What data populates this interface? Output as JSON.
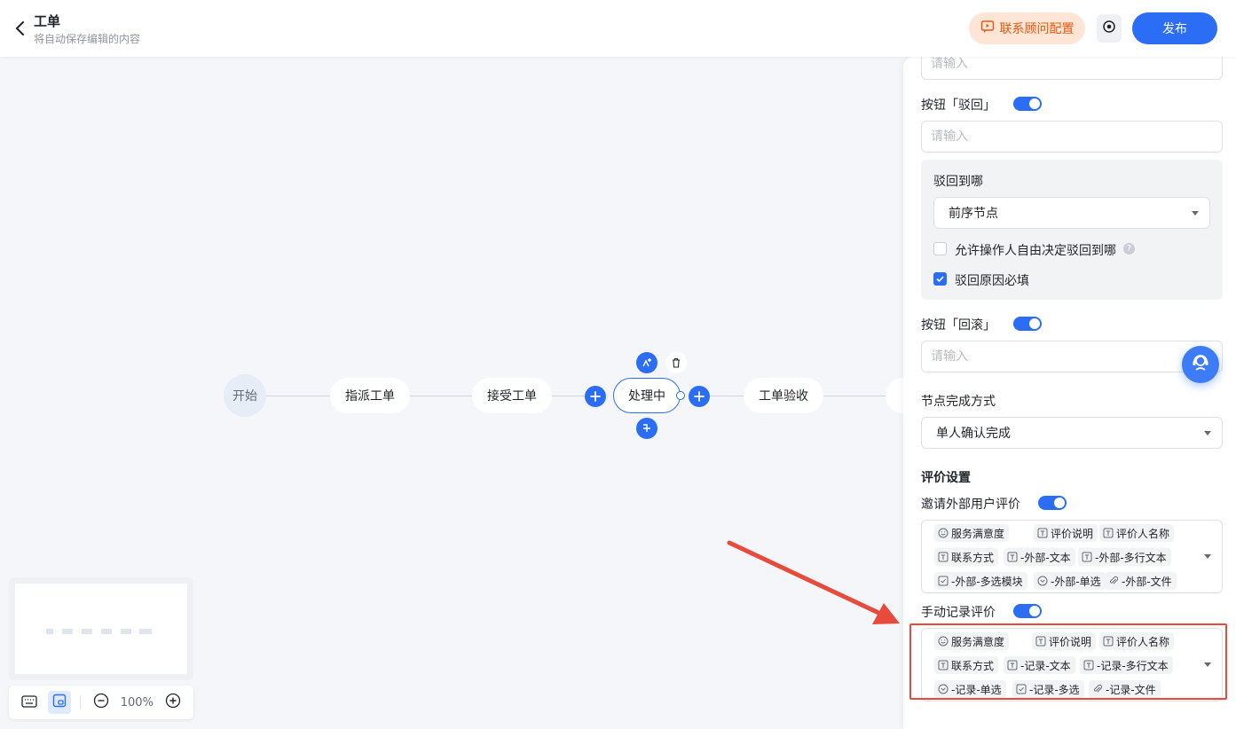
{
  "header": {
    "title": "工单",
    "subtitle": "将自动保存编辑的内容",
    "consult_label": "联系顾问配置",
    "publish_label": "发布"
  },
  "flow": {
    "nodes": [
      "开始",
      "指派工单",
      "接受工单",
      "处理中",
      "工单验收"
    ],
    "active_node": "处理中"
  },
  "zoom": {
    "level": "100%"
  },
  "panel": {
    "top_input_placeholder": "请输入",
    "reject_button_label": "按钮「驳回」",
    "reject_input_placeholder": "请输入",
    "reject_to": {
      "label": "驳回到哪",
      "selected": "前序节点",
      "allow_free_label": "允许操作人自由决定驳回到哪",
      "allow_free_checked": false,
      "reason_required_label": "驳回原因必填",
      "reason_required_checked": true
    },
    "rollback_button_label": "按钮「回滚」",
    "rollback_input_placeholder": "请输入",
    "completion": {
      "label": "节点完成方式",
      "selected": "单人确认完成"
    },
    "evaluation": {
      "title": "评价设置",
      "external_label": "邀请外部用户评价",
      "external_enabled": true,
      "external_tags": [
        {
          "icon": "smile-icon",
          "text": "服务满意度"
        },
        {
          "icon": "text-icon",
          "text": "评价说明"
        },
        {
          "icon": "text-icon",
          "text": "评价人名称"
        },
        {
          "icon": "text-icon",
          "text": "联系方式"
        },
        {
          "icon": "text-icon",
          "text": "-外部-文本"
        },
        {
          "icon": "text-icon",
          "text": "-外部-多行文本"
        },
        {
          "icon": "checkbox-icon",
          "text": "-外部-多选模块"
        },
        {
          "icon": "radio-icon",
          "text": "-外部-单选"
        },
        {
          "icon": "attachment-icon",
          "text": "-外部-文件"
        }
      ],
      "manual_label": "手动记录评价",
      "manual_enabled": true,
      "manual_tags": [
        {
          "icon": "smile-icon",
          "text": "服务满意度"
        },
        {
          "icon": "text-icon",
          "text": "评价说明"
        },
        {
          "icon": "text-icon",
          "text": "评价人名称"
        },
        {
          "icon": "text-icon",
          "text": "联系方式"
        },
        {
          "icon": "text-icon",
          "text": "-记录-文本"
        },
        {
          "icon": "text-icon",
          "text": "-记录-多行文本"
        },
        {
          "icon": "radio-icon",
          "text": "-记录-单选"
        },
        {
          "icon": "checkbox-icon",
          "text": "-记录-多选"
        },
        {
          "icon": "attachment-icon",
          "text": "-记录-文件"
        }
      ]
    }
  },
  "colors": {
    "primary": "#2b6ef5",
    "consult_bg": "#ffe5d6",
    "consult_text": "#e8590c",
    "annotation": "#e84b3c"
  }
}
